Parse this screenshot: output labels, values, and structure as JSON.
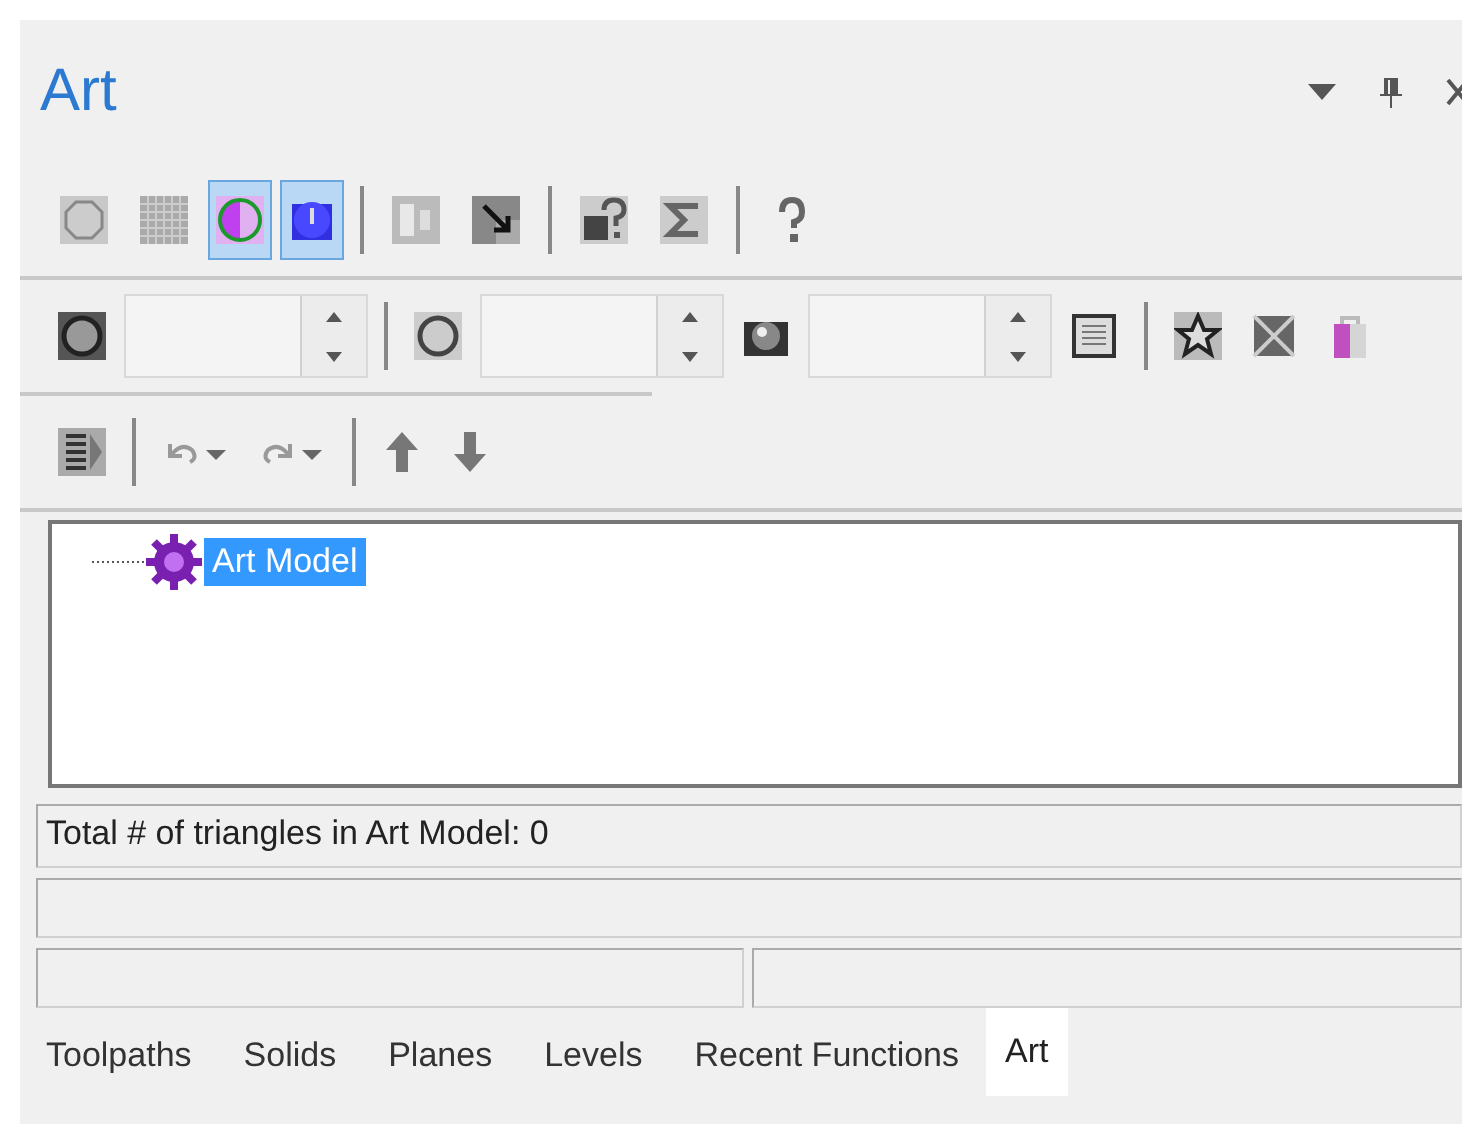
{
  "panel": {
    "title": "Art"
  },
  "toolbar_1": [
    {
      "selected": false
    },
    {
      "selected": false
    },
    {
      "selected": true
    },
    {
      "selected": true
    },
    {
      "selected": false
    },
    {
      "selected": false
    },
    {
      "selected": false
    },
    {
      "selected": false
    },
    {
      "selected": false
    }
  ],
  "tree": {
    "items": [
      {
        "label": "Art Model",
        "selected": true
      }
    ]
  },
  "status_bar": {
    "text": "Total # of triangles in Art Model: 0"
  },
  "tabs": [
    {
      "label": "Toolpaths",
      "selected": false
    },
    {
      "label": "Solids",
      "selected": false
    },
    {
      "label": "Planes",
      "selected": false
    },
    {
      "label": "Levels",
      "selected": false
    },
    {
      "label": "Recent Functions",
      "selected": false
    },
    {
      "label": "Art",
      "selected": true
    }
  ]
}
